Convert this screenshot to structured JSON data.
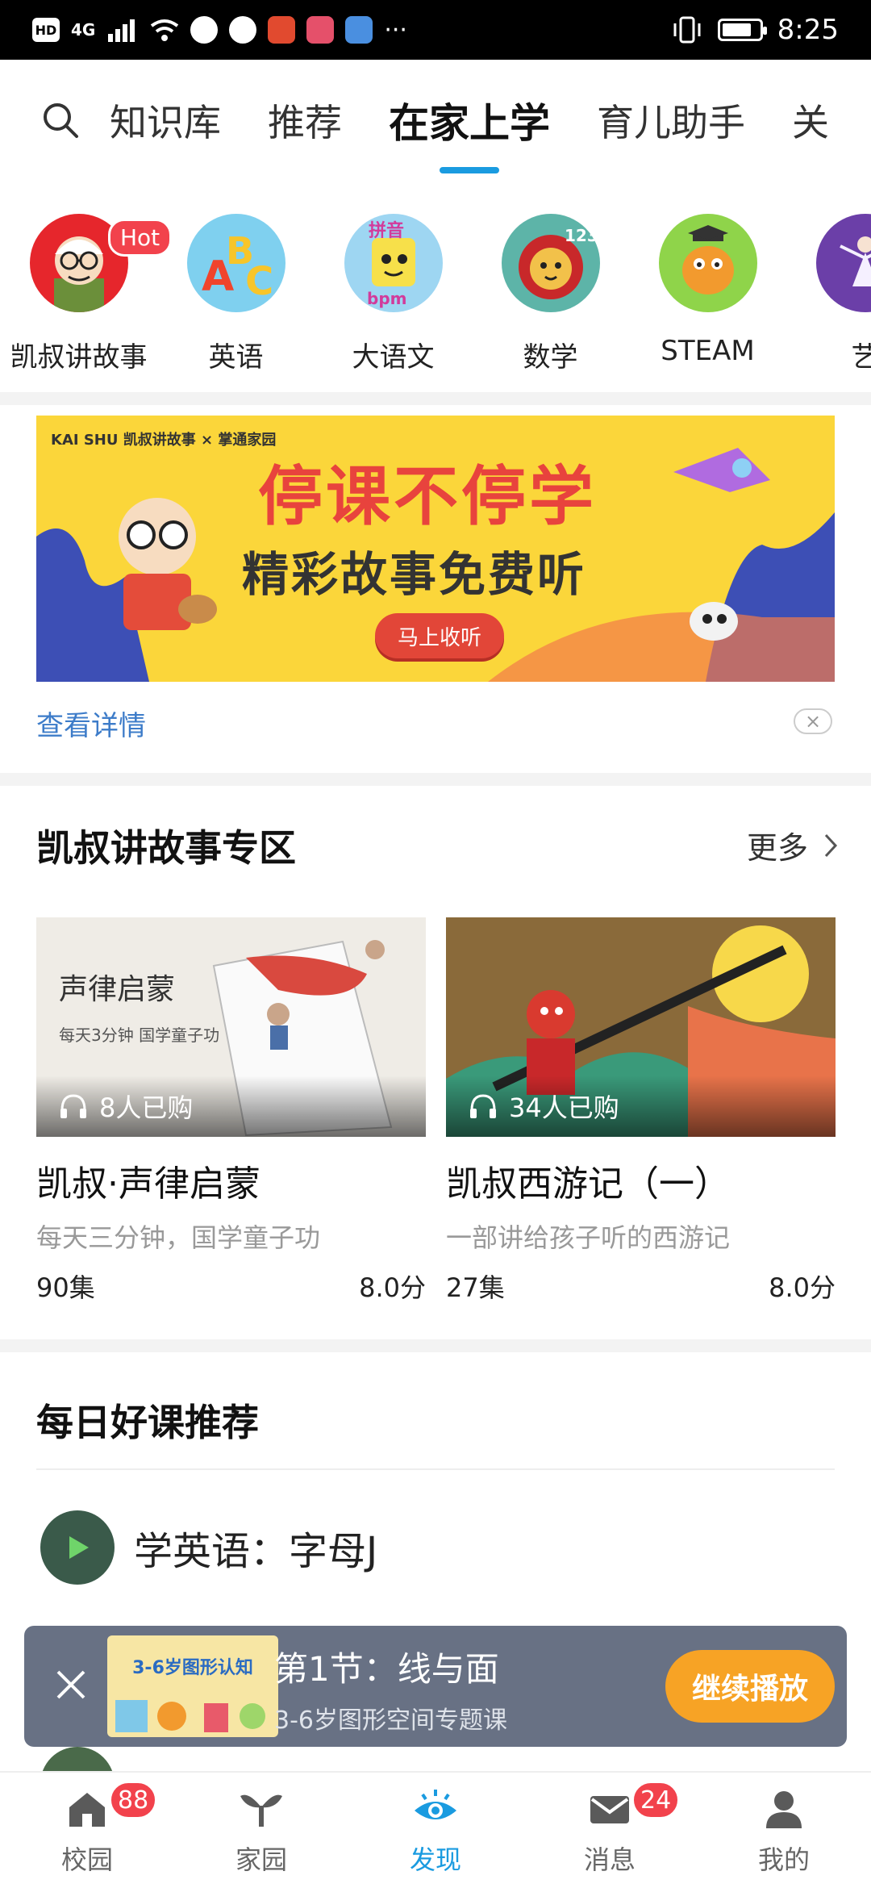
{
  "status_bar": {
    "left_chips": [
      "HD",
      "4G"
    ],
    "time": "8:25",
    "battery_level": 0.8
  },
  "top_tabs": [
    "知识库",
    "推荐",
    "在家上学",
    "育儿助手",
    "关"
  ],
  "active_tab_index": 2,
  "categories": [
    {
      "label": "凯叔讲故事",
      "badge": "Hot",
      "icon": "storyteller-avatar-icon"
    },
    {
      "label": "英语",
      "icon": "abc-icon"
    },
    {
      "label": "大语文",
      "icon": "pinyin-icon"
    },
    {
      "label": "数学",
      "icon": "math-lion-icon"
    },
    {
      "label": "STEAM",
      "icon": "dragon-icon"
    },
    {
      "label": "艺",
      "icon": "art-dancer-icon"
    }
  ],
  "banner": {
    "logo_text": "KAI SHU 凯叔讲故事 × 掌通家园",
    "headline": "停课不停学",
    "subline": "精彩故事免费听",
    "button": "马上收听",
    "details_link": "查看详情",
    "close": "×"
  },
  "section_story": {
    "title": "凯叔讲故事专区",
    "more": "更多",
    "cards": [
      {
        "thumb_text": "声律启蒙",
        "thumb_sub": "每天3分钟 国学童子功",
        "buyers": "8人已购",
        "title": "凯叔·声律启蒙",
        "subtitle": "每天三分钟，国学童子功",
        "episodes": "90集",
        "score": "8.0分"
      },
      {
        "buyers": "34人已购",
        "title": "凯叔西游记（一）",
        "subtitle": "一部讲给孩子听的西游记",
        "episodes": "27集",
        "score": "8.0分"
      }
    ]
  },
  "section_daily": {
    "title": "每日好课推荐",
    "items": [
      "学英语：字母J"
    ]
  },
  "mini_player": {
    "thumb_title": "3-6岁图形认知",
    "title": "第1节：线与面",
    "subtitle": "3-6岁图形空间专题课",
    "button": "继续播放"
  },
  "bottom_nav": [
    {
      "label": "校园",
      "badge": "88",
      "icon": "school-icon"
    },
    {
      "label": "家园",
      "icon": "sprout-icon"
    },
    {
      "label": "发现",
      "icon": "eye-icon",
      "active": true
    },
    {
      "label": "消息",
      "badge": "24",
      "icon": "mail-icon"
    },
    {
      "label": "我的",
      "icon": "user-icon"
    }
  ],
  "colors": {
    "accent": "#1a9be0",
    "badge": "#f2424c",
    "play_button": "#f7a325",
    "banner_bg": "#fbd63a"
  }
}
